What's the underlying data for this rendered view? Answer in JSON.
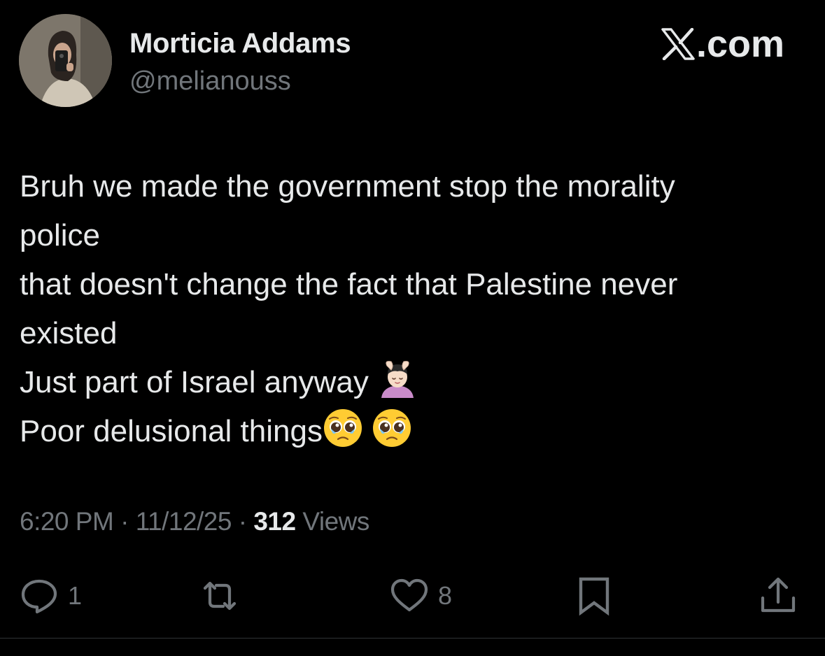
{
  "tweet": {
    "author": {
      "display_name": "Morticia Addams",
      "handle": "@melianouss"
    },
    "brand": {
      "text": ".com",
      "logo_icon": "x-logo-icon"
    },
    "body_lines": [
      "Bruh we made the government stop the morality",
      "police",
      "that doesn't change the fact that Palestine never",
      "existed",
      "Just part of Israel anyway",
      "Poor delusional things"
    ],
    "emojis": {
      "line5": "person-getting-massage-emoji",
      "line6": [
        "pleading-face-emoji",
        "pleading-face-emoji"
      ]
    },
    "meta": {
      "time": "6:20 PM",
      "separator": "·",
      "date": "11/12/25",
      "views_count": "312",
      "views_label": "Views"
    },
    "actions": {
      "reply": {
        "icon": "reply-icon",
        "count": "1"
      },
      "repost": {
        "icon": "repost-icon",
        "count": ""
      },
      "like": {
        "icon": "heart-icon",
        "count": "8"
      },
      "bookmark": {
        "icon": "bookmark-icon"
      },
      "share": {
        "icon": "share-icon"
      }
    },
    "colors": {
      "background": "#000000",
      "primary_text": "#e7e9ea",
      "secondary_text": "#71767b",
      "divider": "#2f3336"
    }
  }
}
